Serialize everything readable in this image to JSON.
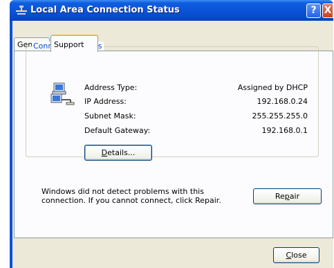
{
  "window": {
    "title": "Local Area Connection Status",
    "help_symbol": "?",
    "close_symbol": "X"
  },
  "tabs": [
    {
      "label": "General",
      "selected": false
    },
    {
      "label": "Support",
      "selected": true
    }
  ],
  "connection_status": {
    "group_label": "Connection status",
    "rows": [
      {
        "label": "Address Type:",
        "value": "Assigned by DHCP"
      },
      {
        "label": "IP Address:",
        "value": "192.168.0.24"
      },
      {
        "label": "Subnet Mask:",
        "value": "255.255.255.0"
      },
      {
        "label": "Default Gateway:",
        "value": "192.168.0.1"
      }
    ],
    "details_button": {
      "accel": "D",
      "rest": "etails..."
    }
  },
  "info_text": "Windows did not detect problems with this connection. If you cannot connect, click Repair.",
  "repair_button": {
    "pre": "Re",
    "accel": "p",
    "rest": "air"
  },
  "close_button": {
    "accel": "C",
    "rest": "lose"
  },
  "colors": {
    "titlebar": "#0a54d8",
    "client": "#ece9d8",
    "group_label": "#0046d5"
  },
  "icons": {
    "title": "network-connection-icon",
    "status": "network-computers-icon"
  }
}
